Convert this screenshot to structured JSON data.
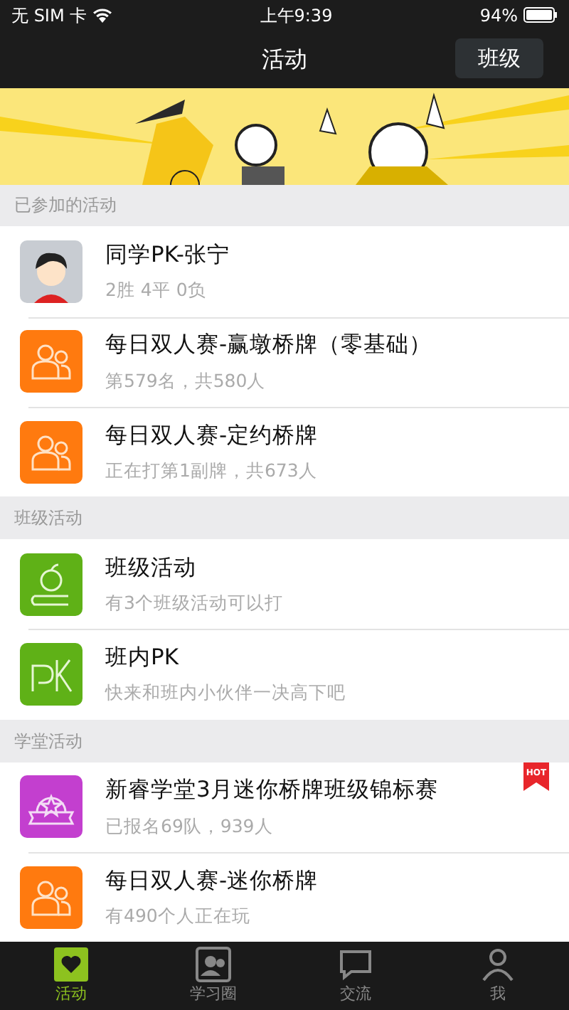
{
  "status_bar": {
    "carrier": "无 SIM 卡",
    "time": "上午9:39",
    "battery": "94%"
  },
  "nav": {
    "title": "活动",
    "button": "班级"
  },
  "sections": [
    {
      "header": "已参加的活动",
      "items": [
        {
          "kind": "avatar",
          "title": "同学PK-张宁",
          "subtitle": "2胜 4平 0负",
          "hot": false
        },
        {
          "kind": "people",
          "title": "每日双人赛-赢墩桥牌（零基础）",
          "subtitle": "第579名，共580人",
          "hot": false
        },
        {
          "kind": "people",
          "title": "每日双人赛-定约桥牌",
          "subtitle": "正在打第1副牌，共673人",
          "hot": false
        }
      ]
    },
    {
      "header": "班级活动",
      "items": [
        {
          "kind": "apple",
          "title": "班级活动",
          "subtitle": "有3个班级活动可以打",
          "hot": false
        },
        {
          "kind": "pk",
          "title": "班内PK",
          "subtitle": "快来和班内小伙伴一决高下吧",
          "hot": false
        }
      ]
    },
    {
      "header": "学堂活动",
      "items": [
        {
          "kind": "medal",
          "title": "新睿学堂3月迷你桥牌班级锦标赛",
          "subtitle": "已报名69队，939人",
          "hot": true
        },
        {
          "kind": "people",
          "title": "每日双人赛-迷你桥牌",
          "subtitle": "有490个人正在玩",
          "hot": false
        }
      ]
    }
  ],
  "hot_label": "HOT",
  "tabs": [
    {
      "label": "活动",
      "kind": "heart",
      "selected": true
    },
    {
      "label": "学习圈",
      "kind": "contacts",
      "selected": false
    },
    {
      "label": "交流",
      "kind": "chat",
      "selected": false
    },
    {
      "label": "我",
      "kind": "person",
      "selected": false
    }
  ]
}
